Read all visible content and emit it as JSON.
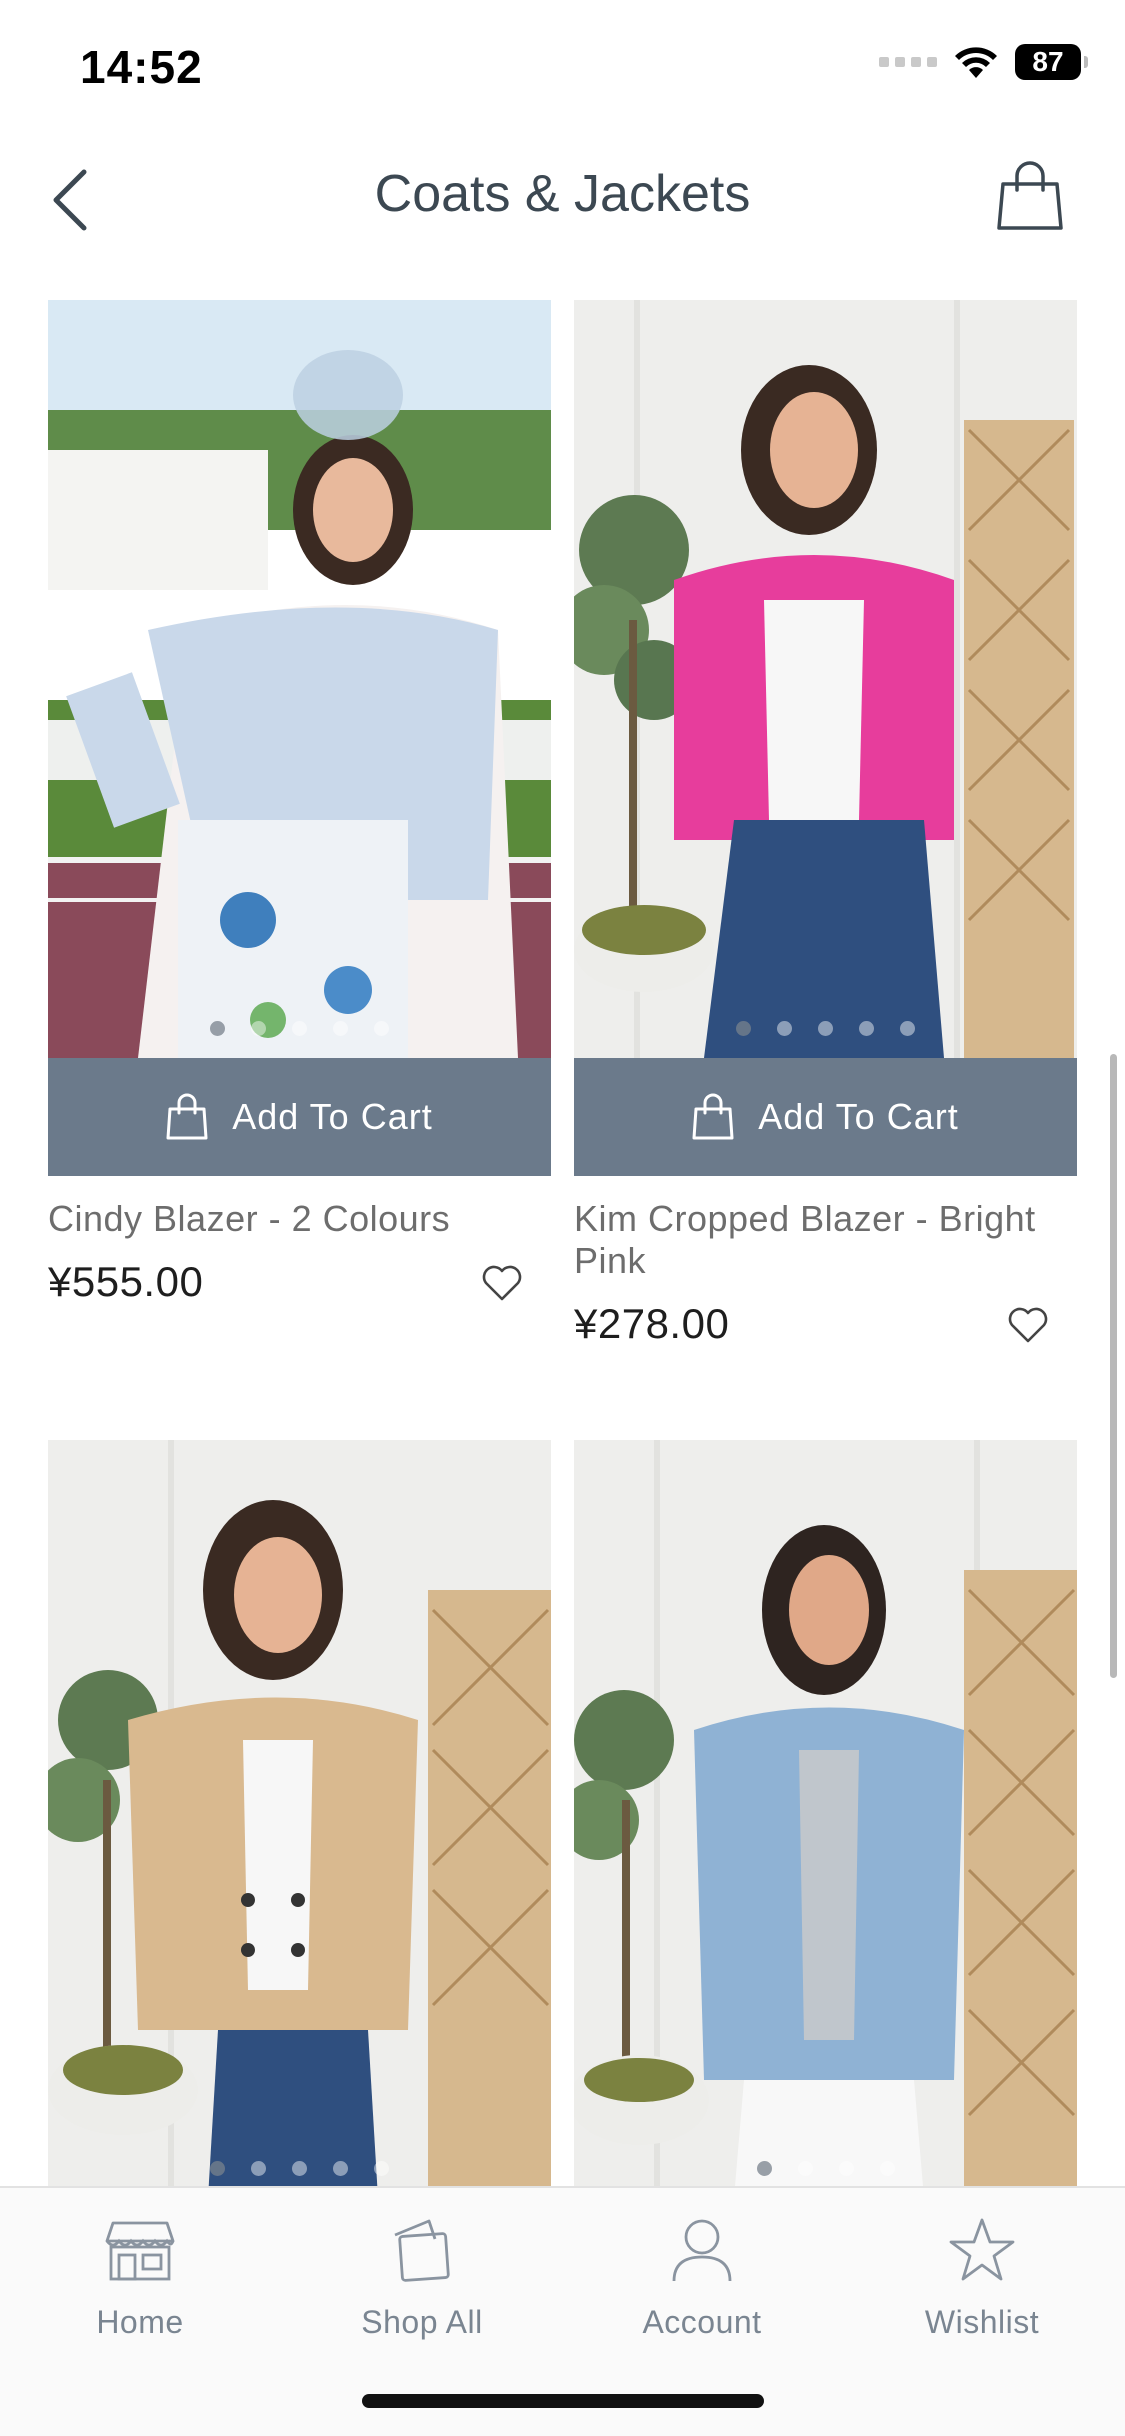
{
  "status_bar": {
    "time": "14:52",
    "battery": "87"
  },
  "header": {
    "title": "Coats & Jackets"
  },
  "products": [
    {
      "name": "Cindy Blazer - 2 Colours",
      "price": "¥555.00",
      "add_to_cart_label": "Add To Cart"
    },
    {
      "name": "Kim Cropped Blazer - Bright Pink",
      "price": "¥278.00",
      "add_to_cart_label": "Add To Cart"
    },
    {
      "name": "",
      "price": "",
      "add_to_cart_label": ""
    },
    {
      "name": "",
      "price": "",
      "add_to_cart_label": ""
    }
  ],
  "tab_bar": {
    "items": [
      {
        "label": "Home",
        "icon": "store-icon"
      },
      {
        "label": "Shop All",
        "icon": "shopping-bag-icon"
      },
      {
        "label": "Account",
        "icon": "user-icon"
      },
      {
        "label": "Wishlist",
        "icon": "star-icon"
      }
    ]
  },
  "colors": {
    "accent": "#6b7a8b",
    "title": "#3c4852",
    "tab_label": "#7a8591"
  }
}
